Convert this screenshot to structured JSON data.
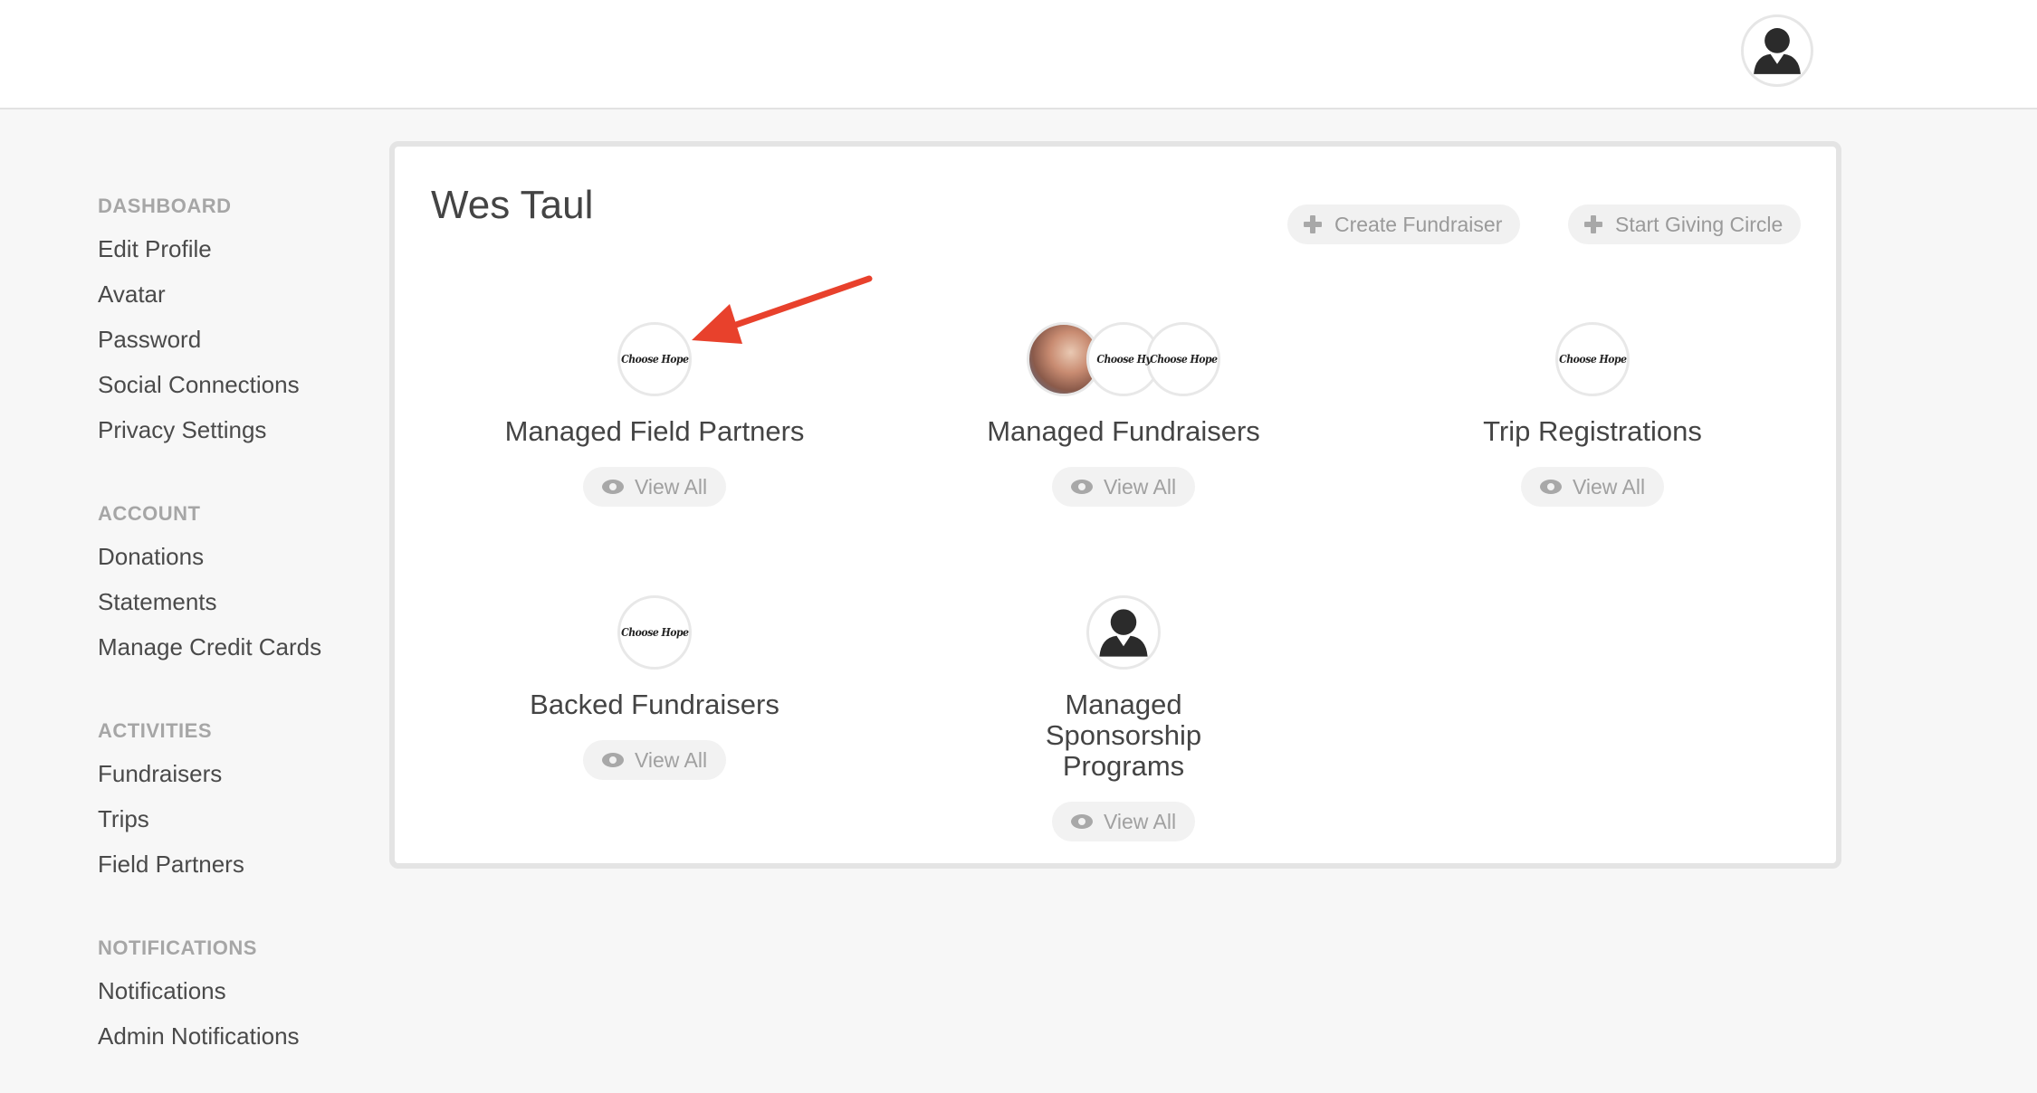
{
  "header": {
    "avatar_icon": "person-silhouette-icon"
  },
  "sidebar": {
    "groups": [
      {
        "heading": "DASHBOARD",
        "items": [
          "Edit Profile",
          "Avatar",
          "Password",
          "Social Connections",
          "Privacy Settings"
        ]
      },
      {
        "heading": "ACCOUNT",
        "items": [
          "Donations",
          "Statements",
          "Manage Credit Cards"
        ]
      },
      {
        "heading": "ACTIVITIES",
        "items": [
          "Fundraisers",
          "Trips",
          "Field Partners"
        ]
      },
      {
        "heading": "NOTIFICATIONS",
        "items": [
          "Notifications",
          "Admin Notifications"
        ]
      }
    ]
  },
  "main": {
    "title": "Wes Taul",
    "actions": {
      "create_fundraiser": "Create Fundraiser",
      "start_giving_circle": "Start Giving Circle"
    },
    "logo_text": "Choose Hope",
    "logo_text_cropped": "Choose Hy",
    "tiles": [
      {
        "label": "Managed Field Partners",
        "view_label": "View All"
      },
      {
        "label": "Managed Fundraisers",
        "view_label": "View All"
      },
      {
        "label": "Trip Registrations",
        "view_label": "View All"
      },
      {
        "label": "Backed Fundraisers",
        "view_label": "View All"
      },
      {
        "label": "Managed Sponsorship Programs",
        "view_label": "View All"
      }
    ]
  },
  "colors": {
    "annotation_arrow": "#e8412c",
    "page_background": "#f7f7f7",
    "card_border": "#e4e4e4"
  }
}
